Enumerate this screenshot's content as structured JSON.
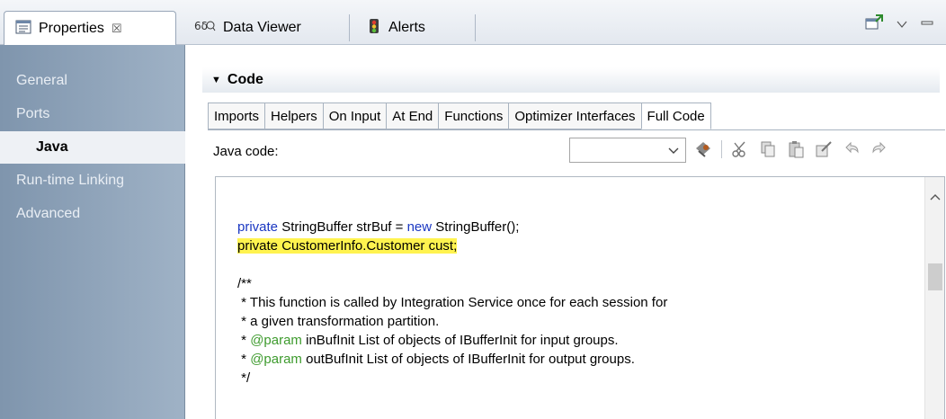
{
  "tabs": [
    {
      "label": "Properties",
      "icon": "properties-icon",
      "close": "☒"
    },
    {
      "label": "Data Viewer",
      "icon": "data-viewer-icon"
    },
    {
      "label": "Alerts",
      "icon": "alerts-icon"
    }
  ],
  "nav": {
    "items": [
      {
        "label": "General"
      },
      {
        "label": "Ports"
      },
      {
        "label": "Java"
      },
      {
        "label": "Run-time Linking"
      },
      {
        "label": "Advanced"
      }
    ],
    "active_index": 2
  },
  "section": {
    "title": "Code"
  },
  "subtabs": [
    "Imports",
    "Helpers",
    "On Input",
    "At End",
    "Functions",
    "Optimizer Interfaces",
    "Full Code"
  ],
  "active_subtab": "Full Code",
  "toolbar": {
    "label": "Java code:",
    "dropdown_value": "",
    "icons": [
      "import-icon",
      "cut-icon",
      "copy-icon",
      "paste-icon",
      "edit-icon",
      "undo-icon",
      "redo-icon"
    ]
  },
  "code": {
    "line1": {
      "kw1": "private",
      "t1": " StringBuffer strBuf = ",
      "kw2": "new",
      "t2": " StringBuffer();"
    },
    "line2": {
      "text": "private CustomerInfo.Customer cust;"
    },
    "line3": {
      "text": "/**"
    },
    "line4": {
      "text": " * This function is called by Integration Service once for each session for"
    },
    "line5": {
      "text": " * a given transformation partition."
    },
    "line6": {
      "pre": " * ",
      "ann": "@param",
      "post": " inBufInit List of objects of IBufferInit for input groups."
    },
    "line7": {
      "pre": " * ",
      "ann": "@param",
      "post": " outBufInit List of objects of IBufferInit for output groups."
    },
    "line8": {
      "text": " */"
    }
  },
  "colors": {
    "keyword": "#1a37c2",
    "annotation": "#3e9b2e",
    "highlight": "#fff34f",
    "nav_bg": "#8fa3b9"
  }
}
